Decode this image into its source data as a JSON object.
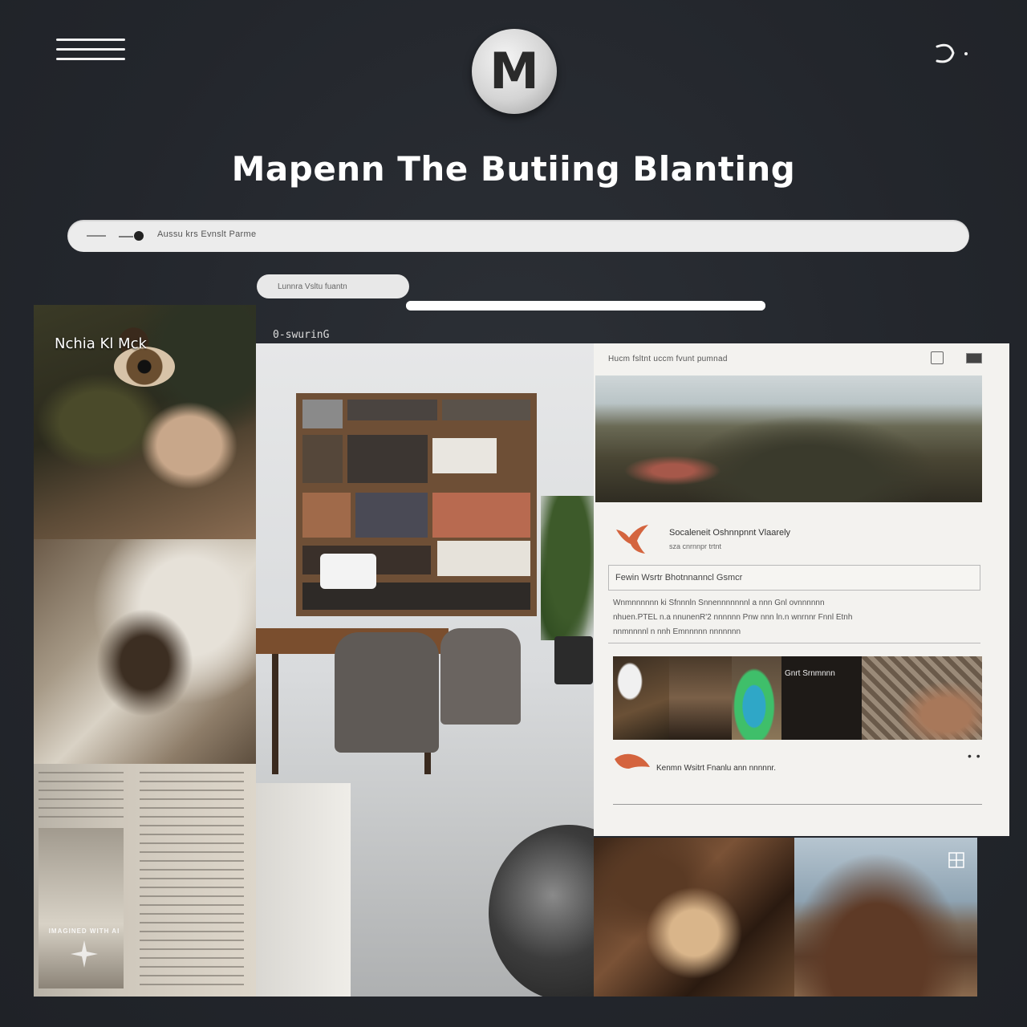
{
  "header": {
    "logo_letter": "M",
    "title": "Mapenn The Butiing Blanting"
  },
  "search": {
    "text": "Aussu krs Evnslt Parme"
  },
  "filter": {
    "label": "Lunnra Vsltu fuantn",
    "progress": 1.0
  },
  "left_column": {
    "caption": "Nchia Kl  Mck"
  },
  "center": {
    "section_label": "0-swurinG"
  },
  "panel": {
    "header_text": "Hucm fsltnt uccm fvunt pumnad",
    "post": {
      "title": "Socaleneit  Oshnnpnnt Vlaarely",
      "subtitle": "sza  cnrnnpr  trtnt"
    },
    "input_value": "Fewin  Wsrtr  Bhotnnanncl  Gsmcr",
    "textarea_lines": [
      "Wnmnnnnnn  ki  Sfnnnln  Snnennnnnnnl  a  nnn  Gnl  ovnnnnnn",
      "nhuen.PTEL  n.a  nnunenR'2  nnnnnn  Pnw  nnn  ln.n  wnrnnr  Fnnl  Etnh",
      "nnmnnnnl  n  nnh  Emnnnnn  nnnnnnn"
    ],
    "thumb_caption": "Gnrt  Srnmnnn",
    "comment_text": "Kenmn  Wsitrt  Fnanlu  ann  nnnnnr.",
    "more_label": "• •"
  },
  "watermark": {
    "text": "IMAGINED WITH AI"
  },
  "colors": {
    "background": "#25282e",
    "panel": "#f3f2ef",
    "accent_bird": "#d4643e"
  }
}
